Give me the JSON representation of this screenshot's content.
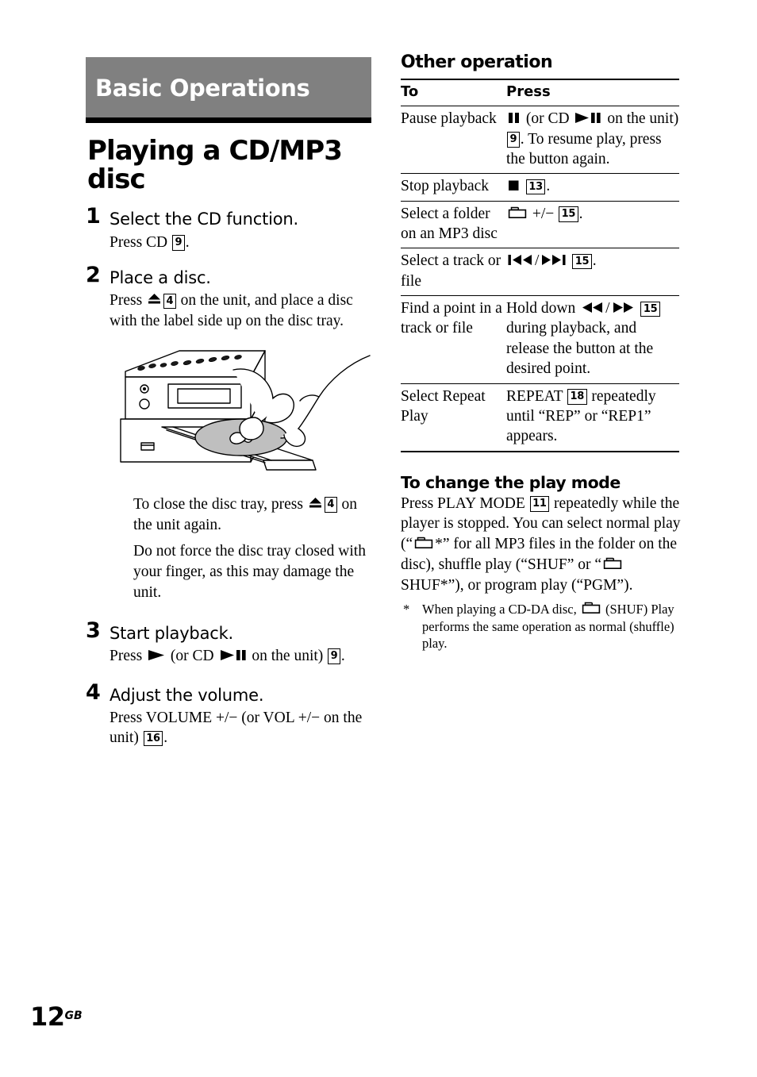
{
  "chapter": {
    "banner_title": "Basic Operations"
  },
  "page_title": "Playing a CD/MP3 disc",
  "steps": [
    {
      "number": "1",
      "heading": "Select the CD function.",
      "body_pre": "Press CD ",
      "key": "9",
      "body_post": "."
    },
    {
      "number": "2",
      "heading": "Place a disc.",
      "body_pre": "Press ",
      "icon": "eject-icon",
      "key": "4",
      "body_post": " on the unit, and place a disc with the label side up on the disc tray."
    },
    {
      "number": "3",
      "heading": "Start playback.",
      "body_pre": "Press ",
      "icon": "play-icon",
      "body_mid": " (or CD ",
      "icon2": "play-pause-icon",
      "body_post": " on the unit) ",
      "key": "9",
      "body_end": "."
    },
    {
      "number": "4",
      "heading": "Adjust the volume.",
      "body_pre": "Press VOLUME +/− (or VOL +/− on the unit) ",
      "key": "16",
      "body_post": "."
    }
  ],
  "illustration": {
    "alt": "stereo unit with open disc tray and hand placing a CD",
    "disc_fill": "#bfbfbf"
  },
  "notes": [
    {
      "pre": "To close the disc tray, press ",
      "icon": "eject-icon",
      "key": "4",
      "post": " on the unit again."
    },
    {
      "pre": "Do not force the disc tray closed with your finger, as this may damage the unit.",
      "icon": "",
      "key": "",
      "post": ""
    }
  ],
  "other_operation": {
    "heading": "Other operation",
    "columns": {
      "to": "To",
      "press": "Press"
    },
    "rows": [
      {
        "to": "Pause playback",
        "press_parts": [
          {
            "type": "icon",
            "value": "pause-icon"
          },
          {
            "type": "text",
            "value": " (or CD "
          },
          {
            "type": "icon",
            "value": "play-pause-icon"
          },
          {
            "type": "text",
            "value": " on the unit) "
          },
          {
            "type": "key",
            "value": "9"
          },
          {
            "type": "text",
            "value": ". To resume play, press the button again."
          }
        ]
      },
      {
        "to": "Stop playback",
        "press_parts": [
          {
            "type": "icon",
            "value": "stop-icon"
          },
          {
            "type": "text",
            "value": " "
          },
          {
            "type": "key",
            "value": "13"
          },
          {
            "type": "text",
            "value": "."
          }
        ]
      },
      {
        "to": "Select a folder on an MP3 disc",
        "press_parts": [
          {
            "type": "icon",
            "value": "folder-icon"
          },
          {
            "type": "text",
            "value": " +/− "
          },
          {
            "type": "key",
            "value": "15"
          },
          {
            "type": "text",
            "value": "."
          }
        ]
      },
      {
        "to": "Select a track or file",
        "press_parts": [
          {
            "type": "icon",
            "value": "skip-back-icon"
          },
          {
            "type": "text",
            "value": "/"
          },
          {
            "type": "icon",
            "value": "skip-forward-icon"
          },
          {
            "type": "text",
            "value": " "
          },
          {
            "type": "key",
            "value": "15"
          },
          {
            "type": "text",
            "value": "."
          }
        ]
      },
      {
        "to": "Find a point in a track or file",
        "press_parts": [
          {
            "type": "text",
            "value": "Hold down "
          },
          {
            "type": "icon",
            "value": "rewind-icon"
          },
          {
            "type": "text",
            "value": "/"
          },
          {
            "type": "icon",
            "value": "fast-forward-icon"
          },
          {
            "type": "text",
            "value": " "
          },
          {
            "type": "key",
            "value": "15"
          },
          {
            "type": "text",
            "value": " during playback, and release the button at the desired point."
          }
        ]
      },
      {
        "to": "Select Repeat Play",
        "press_parts": [
          {
            "type": "text",
            "value": "REPEAT "
          },
          {
            "type": "key",
            "value": "18"
          },
          {
            "type": "text",
            "value": " repeatedly until “REP” or “REP1” appears."
          }
        ]
      }
    ]
  },
  "play_mode": {
    "heading": "To change the play mode",
    "parts": [
      {
        "type": "text",
        "value": "Press PLAY MODE "
      },
      {
        "type": "key",
        "value": "11"
      },
      {
        "type": "text",
        "value": " repeatedly while the player is stopped. You can select normal play (“"
      },
      {
        "type": "icon",
        "value": "folder-icon"
      },
      {
        "type": "text",
        "value": "*” for all MP3 files in the folder on the disc), shuffle play (“SHUF” or “"
      },
      {
        "type": "icon",
        "value": "folder-icon"
      },
      {
        "type": "text",
        "value": " SHUF*”), or program play (“PGM”)."
      }
    ],
    "footnote": {
      "mark": "*",
      "parts": [
        {
          "type": "text",
          "value": "When playing a CD-DA disc, "
        },
        {
          "type": "icon",
          "value": "folder-icon"
        },
        {
          "type": "text",
          "value": " (SHUF) Play performs the same operation as normal (shuffle) play."
        }
      ]
    }
  },
  "page_number": {
    "number": "12",
    "suffix": "GB"
  }
}
